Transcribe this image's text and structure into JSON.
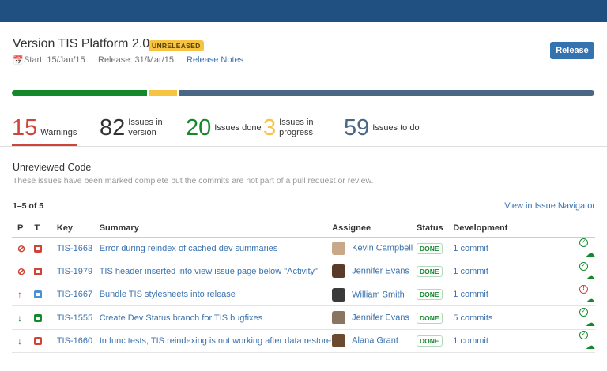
{
  "header": {
    "title": "Version TIS Platform 2.0",
    "badge": "UNRELEASED",
    "start": "Start: 15/Jan/15",
    "release_date": "Release: 31/Mar/15",
    "release_notes": "Release Notes",
    "release_button": "Release"
  },
  "progress": {
    "done": 20,
    "in_progress": 3,
    "to_do": 59,
    "colors": {
      "done": "#14892c",
      "in_progress": "#f6c342",
      "to_do": "#4a6785"
    }
  },
  "stats": [
    {
      "value": "15",
      "label": "Warnings",
      "color": "#d04437"
    },
    {
      "value": "82",
      "label": "Issues in version",
      "color": "#333333"
    },
    {
      "value": "20",
      "label": "Issues done",
      "color": "#14892c"
    },
    {
      "value": "3",
      "label": "Issues in progress",
      "color": "#f6c342"
    },
    {
      "value": "59",
      "label": "Issues to do",
      "color": "#4a6785"
    }
  ],
  "section": {
    "title": "Unreviewed Code",
    "description": "These issues have been marked complete but the commits are not part of a pull request or review.",
    "count": "1–5 of 5",
    "navigator_link": "View in Issue Navigator"
  },
  "table": {
    "headers": [
      "P",
      "T",
      "Key",
      "Summary",
      "Assignee",
      "Status",
      "Development"
    ],
    "rows": [
      {
        "priority": "blocker",
        "type": "bug",
        "key": "TIS-1663",
        "summary": "Error during reindex of cached dev summaries",
        "assignee": "Kevin Campbell",
        "status": "DONE",
        "dev": "1 commit",
        "build": "passed"
      },
      {
        "priority": "blocker",
        "type": "bug",
        "key": "TIS-1979",
        "summary": "TIS header inserted into view issue page below \"Activity\"",
        "assignee": "Jennifer Evans",
        "status": "DONE",
        "dev": "1 commit",
        "build": "passed"
      },
      {
        "priority": "critical",
        "type": "task",
        "key": "TIS-1667",
        "summary": "Bundle TIS stylesheets into release",
        "assignee": "William Smith",
        "status": "DONE",
        "dev": "1 commit",
        "build": "failed"
      },
      {
        "priority": "minor",
        "type": "story",
        "key": "TIS-1555",
        "summary": "Create Dev Status branch for TIS bugfixes",
        "assignee": "Jennifer Evans",
        "status": "DONE",
        "dev": "5 commits",
        "build": "passed"
      },
      {
        "priority": "minor",
        "type": "bug",
        "key": "TIS-1660",
        "summary": "In func tests, TIS reindexing is not working after data restore",
        "assignee": "Alana Grant",
        "status": "DONE",
        "dev": "1 commit",
        "build": "passed"
      }
    ]
  }
}
